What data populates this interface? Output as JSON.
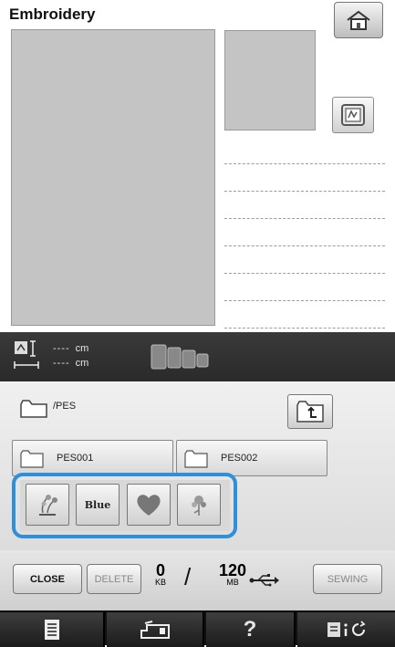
{
  "header": {
    "title": "Embroidery"
  },
  "icons": {
    "home": "home-icon",
    "frame": "embroidery-frame-icon",
    "size": "size-icon",
    "hoops": "hoop-sizes-icon",
    "folder": "folder-icon",
    "up": "folder-up-icon",
    "usb": "usb-icon",
    "list": "list-icon",
    "machine": "machine-icon",
    "help": "help-icon",
    "settings": "settings-icon"
  },
  "size_info": {
    "width_value": "----",
    "width_unit": "cm",
    "height_value": "----",
    "height_unit": "cm"
  },
  "browser": {
    "path": "/PES",
    "folders": [
      {
        "label": "PES001"
      },
      {
        "label": "PES002"
      }
    ],
    "thumbs": [
      {
        "name": "pattern-thumb-1"
      },
      {
        "name": "pattern-thumb-2",
        "text": "Blue"
      },
      {
        "name": "pattern-thumb-3"
      },
      {
        "name": "pattern-thumb-4"
      }
    ]
  },
  "actions": {
    "close_label": "CLOSE",
    "delete_label": "DELETE",
    "sewing_label": "SEWING",
    "memory_used": "0",
    "memory_used_unit": "KB",
    "memory_total": "120",
    "memory_total_unit": "MB"
  },
  "nav": {
    "help_label": "?"
  },
  "colors": {
    "highlight": "#2f8fd9",
    "preview": "#c4c4c4",
    "dark_bar": "#2a2a2a"
  }
}
